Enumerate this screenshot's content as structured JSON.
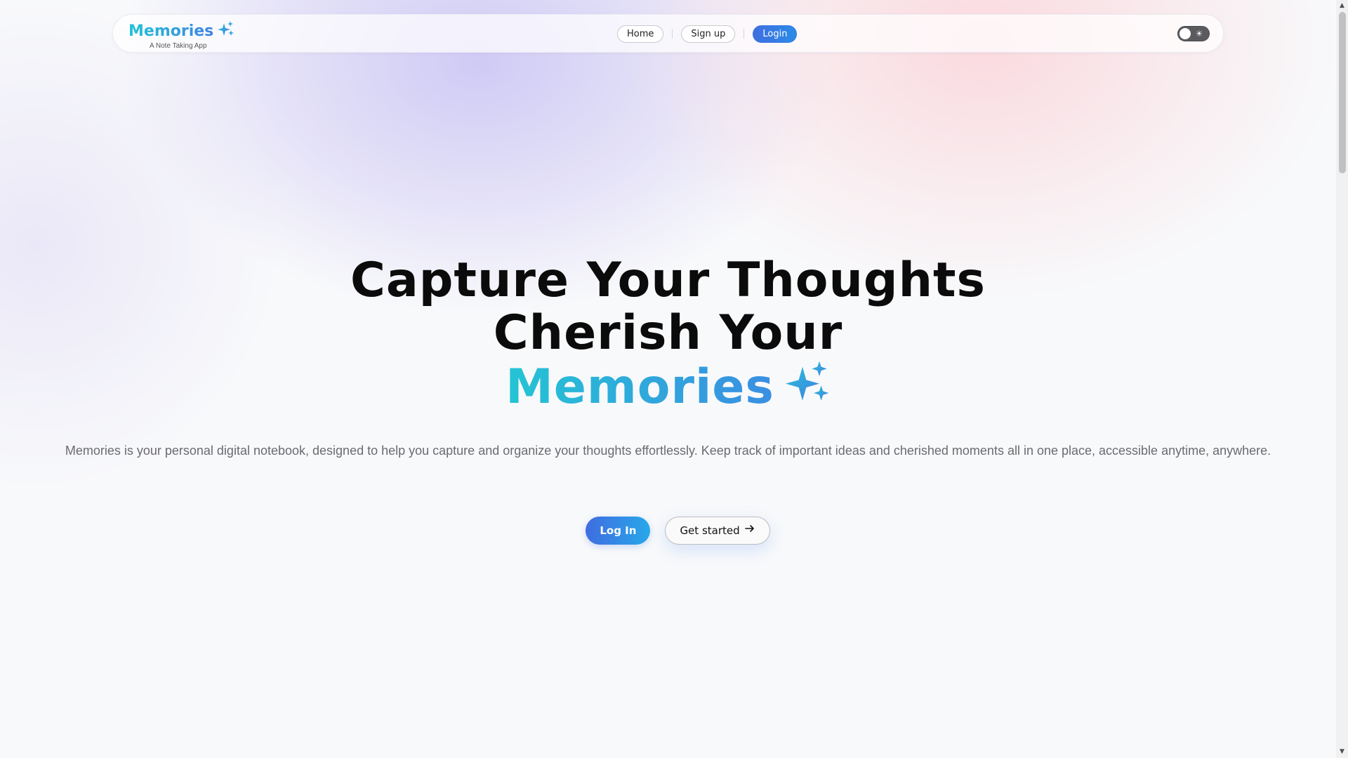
{
  "nav": {
    "brand": "Memories",
    "tagline": "A Note Taking App",
    "links": {
      "home": "Home",
      "signup": "Sign up",
      "login": "Login"
    },
    "theme_toggle_icon": "sun-icon"
  },
  "hero": {
    "line1": "Capture Your Thoughts",
    "line2": "Cherish Your",
    "line3": "Memories",
    "description": "Memories is your personal digital notebook, designed to help you capture and organize your thoughts effortlessly. Keep track of important ideas and cherished moments all in one place, accessible anytime, anywhere.",
    "login_button": "Log In",
    "start_button": "Get started"
  },
  "colors": {
    "brand_gradient_start": "#22c3d6",
    "brand_gradient_end": "#3f83e3",
    "primary_button": "#3f6ee0"
  }
}
